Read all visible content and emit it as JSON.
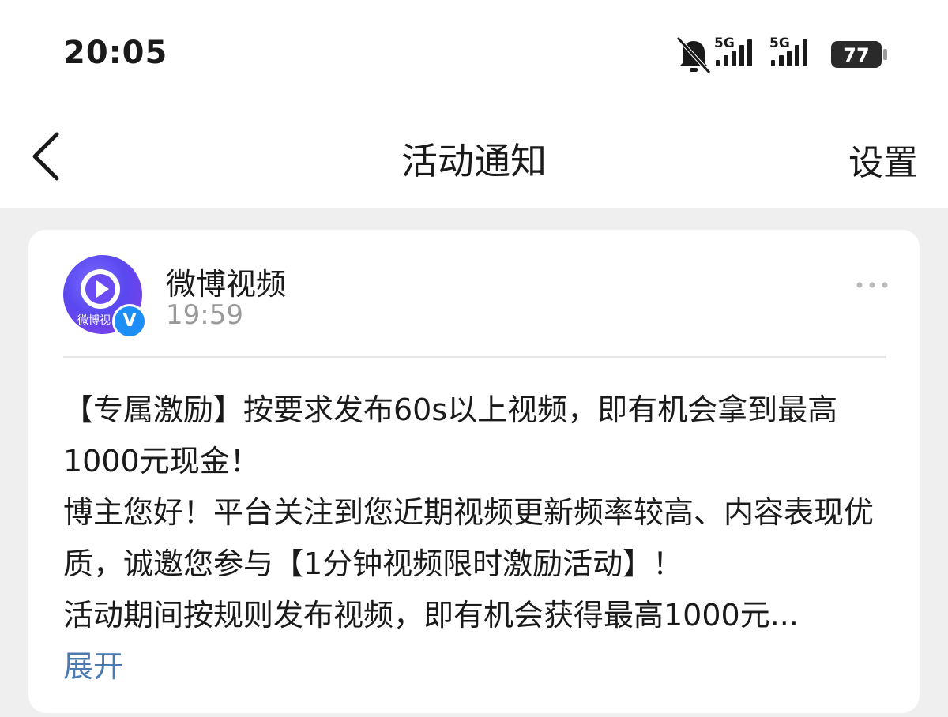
{
  "status_bar": {
    "time": "20:05",
    "network_1": "5G",
    "network_2": "5G",
    "battery": "77",
    "icons": [
      "bell-muted-icon",
      "signal-5g-icon",
      "signal-5g-icon",
      "battery-icon"
    ]
  },
  "navbar": {
    "title": "活动通知",
    "settings_label": "设置",
    "back_icon": "chevron-left-icon"
  },
  "card": {
    "sender_name": "微博视频",
    "sender_time": "19:59",
    "avatar_text": "微博视",
    "verified_label": "V",
    "more_icon": "more-horizontal-icon",
    "paragraphs": [
      "【专属激励】按要求发布60s以上视频，即有机会拿到最高1000元现金！",
      "博主您好！平台关注到您近期视频更新频率较高、内容表现优质，诚邀您参与【1分钟视频限时激励活动】！",
      "活动期间按规则发布视频，即有机会获得最高1000元..."
    ],
    "expand_label": "展开"
  },
  "colors": {
    "background": "#efefef",
    "card": "#ffffff",
    "link": "#4a7ab0",
    "verified": "#1d8ef5"
  }
}
